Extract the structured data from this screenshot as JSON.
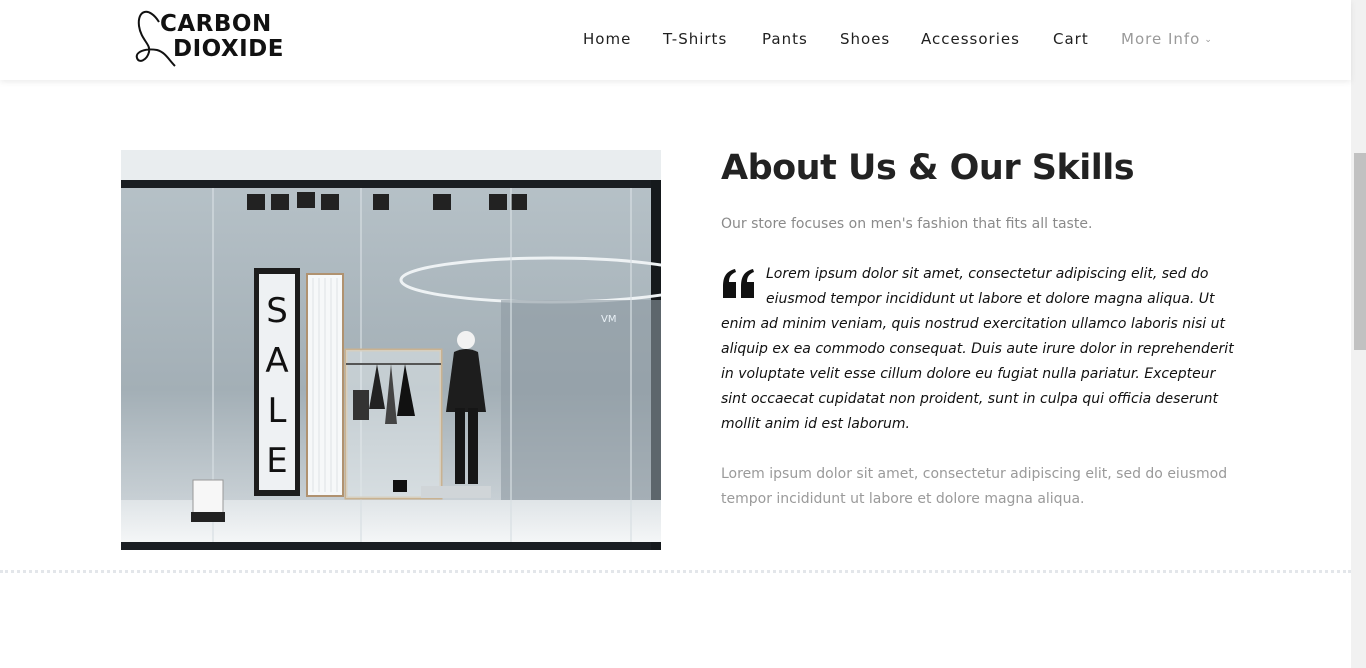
{
  "brand": {
    "logo_line1": "CARBON",
    "logo_line2": "DIOXIDE"
  },
  "nav": {
    "items": [
      {
        "label": "Home"
      },
      {
        "label": "T-Shirts"
      },
      {
        "label": "Pants"
      },
      {
        "label": "Shoes"
      },
      {
        "label": "Accessories"
      },
      {
        "label": "Cart"
      },
      {
        "label": "More Info"
      }
    ]
  },
  "about": {
    "image_sign": "SALE",
    "title": "About Us & Our Skills",
    "intro": "Our store focuses on men's fashion that fits all taste.",
    "quote": "Lorem ipsum dolor sit amet, consectetur adipiscing elit, sed do eiusmod tempor incididunt ut labore et dolore magna aliqua. Ut enim ad minim veniam, quis nostrud exercitation ullamco laboris nisi ut aliquip ex ea commodo consequat. Duis aute irure dolor in reprehenderit in voluptate velit esse cillum dolore eu fugiat nulla pariatur. Excepteur sint occaecat cupidatat non proident, sunt in culpa qui officia deserunt mollit anim id est laborum.",
    "body": "Lorem ipsum dolor sit amet, consectetur adipiscing elit, sed do eiusmod tempor incididunt ut labore et dolore magna aliqua."
  },
  "colors": {
    "heading": "#222222",
    "muted_text": "#8a8a8a",
    "nav_muted": "#9a9a9a"
  }
}
